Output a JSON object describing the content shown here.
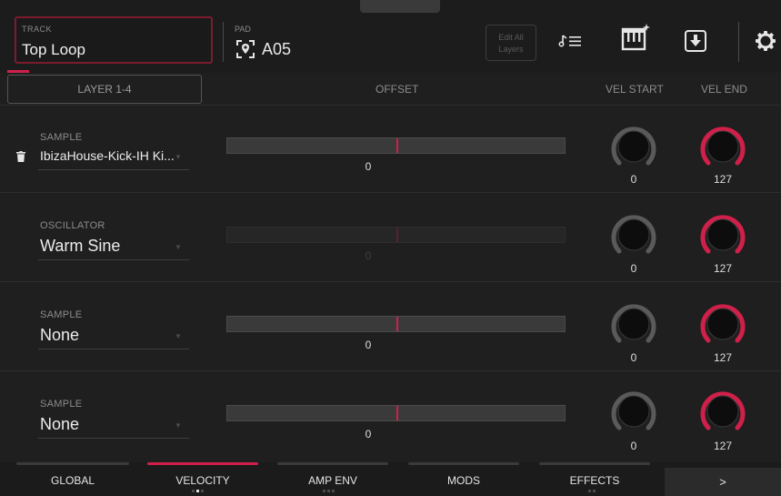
{
  "header": {
    "track_label": "TRACK",
    "track_name": "Top Loop",
    "pad_label": "PAD",
    "pad_value": "A05",
    "edit_all_line1": "Edit All",
    "edit_all_line2": "Layers",
    "icons": [
      "pad-location-icon",
      "note-list-icon",
      "keyboard-sparkle-icon",
      "download-icon",
      "gear-icon"
    ]
  },
  "columns": {
    "layer": "LAYER 1-4",
    "offset": "OFFSET",
    "vel_start": "VEL START",
    "vel_end": "VEL END"
  },
  "rows": [
    {
      "kind": "SAMPLE",
      "value": "IbizaHouse-Kick-IH Ki...",
      "offset": "0",
      "vel_start": "0",
      "vel_end": "127",
      "active": true,
      "has_trash": true
    },
    {
      "kind": "OSCILLATOR",
      "value": "Warm Sine",
      "offset": "0",
      "vel_start": "0",
      "vel_end": "127",
      "active": false,
      "has_trash": false
    },
    {
      "kind": "SAMPLE",
      "value": "None",
      "offset": "0",
      "vel_start": "0",
      "vel_end": "127",
      "active": true,
      "has_trash": false
    },
    {
      "kind": "SAMPLE",
      "value": "None",
      "offset": "0",
      "vel_start": "0",
      "vel_end": "127",
      "active": true,
      "has_trash": false
    }
  ],
  "nav": {
    "tabs": [
      "GLOBAL",
      "VELOCITY",
      "AMP ENV",
      "MODS",
      "EFFECTS"
    ],
    "active": "VELOCITY",
    "more": ">"
  },
  "colors": {
    "accent": "#d0204a",
    "knob_off": "#5a5a5a",
    "background": "#1f1f1f"
  }
}
